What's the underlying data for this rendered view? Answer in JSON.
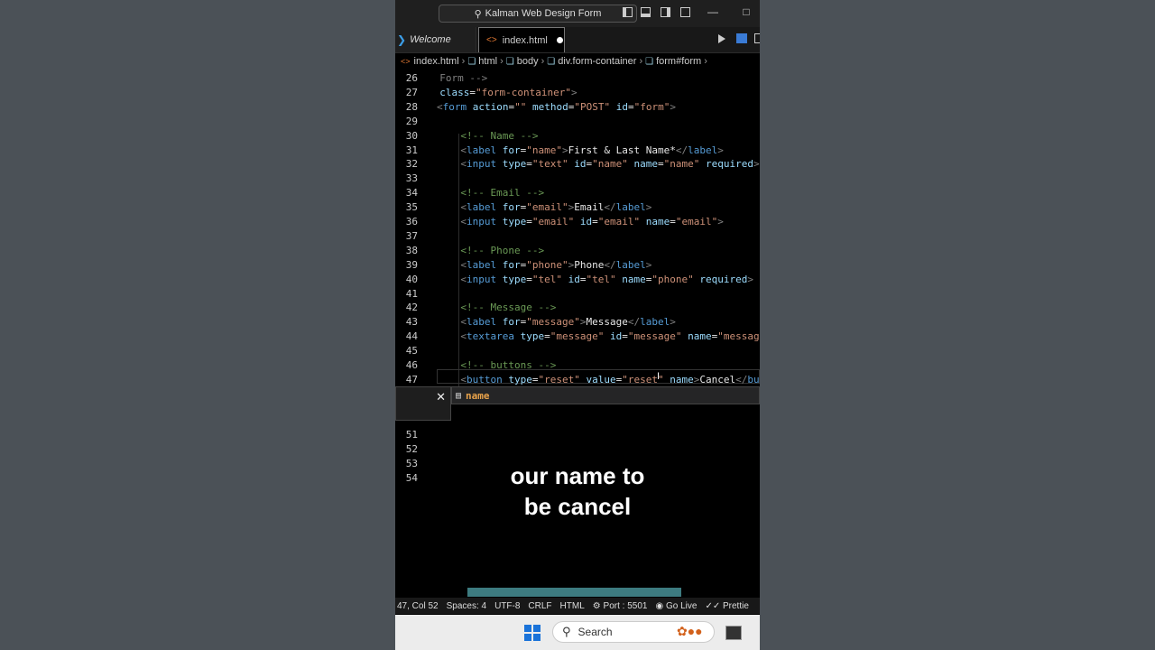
{
  "titlebar": {
    "search_text": "Kalman Web Design Form"
  },
  "tabs": [
    {
      "label": "Welcome"
    },
    {
      "label": "index.html"
    }
  ],
  "breadcrumb": [
    "index.html",
    "html",
    "body",
    "div.form-container",
    "form#form"
  ],
  "editor": {
    "lines": [
      {
        "n": "26",
        "indent": 0.5,
        "parts": [
          {
            "t": "tag",
            "v": "Form -->"
          }
        ]
      },
      {
        "n": "27",
        "indent": 0.5,
        "parts": [
          {
            "t": "attr",
            "v": "class"
          },
          {
            "t": "text",
            "v": "="
          },
          {
            "t": "str",
            "v": "\"form-container\""
          },
          {
            "t": "tag",
            "v": ">"
          }
        ]
      },
      {
        "n": "28",
        "indent": 0,
        "parts": [
          {
            "t": "tag",
            "v": "<"
          },
          {
            "t": "name",
            "v": "form"
          },
          {
            "t": "text",
            "v": " "
          },
          {
            "t": "attr",
            "v": "action"
          },
          {
            "t": "text",
            "v": "="
          },
          {
            "t": "str",
            "v": "\"\""
          },
          {
            "t": "text",
            "v": " "
          },
          {
            "t": "attr",
            "v": "method"
          },
          {
            "t": "text",
            "v": "="
          },
          {
            "t": "str",
            "v": "\"POST\""
          },
          {
            "t": "text",
            "v": " "
          },
          {
            "t": "attr",
            "v": "id"
          },
          {
            "t": "text",
            "v": "="
          },
          {
            "t": "str",
            "v": "\"form\""
          },
          {
            "t": "tag",
            "v": ">"
          }
        ]
      },
      {
        "n": "29",
        "indent": 0,
        "parts": []
      },
      {
        "n": "30",
        "indent": 4,
        "parts": [
          {
            "t": "com",
            "v": "<!-- Name -->"
          }
        ]
      },
      {
        "n": "31",
        "indent": 4,
        "parts": [
          {
            "t": "tag",
            "v": "<"
          },
          {
            "t": "name",
            "v": "label"
          },
          {
            "t": "text",
            "v": " "
          },
          {
            "t": "attr",
            "v": "for"
          },
          {
            "t": "text",
            "v": "="
          },
          {
            "t": "str",
            "v": "\"name\""
          },
          {
            "t": "tag",
            "v": ">"
          },
          {
            "t": "text",
            "v": "First & Last Name*"
          },
          {
            "t": "tag",
            "v": "</"
          },
          {
            "t": "name",
            "v": "label"
          },
          {
            "t": "tag",
            "v": ">"
          }
        ]
      },
      {
        "n": "32",
        "indent": 4,
        "parts": [
          {
            "t": "tag",
            "v": "<"
          },
          {
            "t": "name",
            "v": "input"
          },
          {
            "t": "text",
            "v": " "
          },
          {
            "t": "attr",
            "v": "type"
          },
          {
            "t": "text",
            "v": "="
          },
          {
            "t": "str",
            "v": "\"text\""
          },
          {
            "t": "text",
            "v": " "
          },
          {
            "t": "attr",
            "v": "id"
          },
          {
            "t": "text",
            "v": "="
          },
          {
            "t": "str",
            "v": "\"name\""
          },
          {
            "t": "text",
            "v": " "
          },
          {
            "t": "attr",
            "v": "name"
          },
          {
            "t": "text",
            "v": "="
          },
          {
            "t": "str",
            "v": "\"name\""
          },
          {
            "t": "text",
            "v": " "
          },
          {
            "t": "attr",
            "v": "required"
          },
          {
            "t": "tag",
            "v": ">"
          }
        ]
      },
      {
        "n": "33",
        "indent": 0,
        "parts": []
      },
      {
        "n": "34",
        "indent": 4,
        "parts": [
          {
            "t": "com",
            "v": "<!-- Email -->"
          }
        ]
      },
      {
        "n": "35",
        "indent": 4,
        "parts": [
          {
            "t": "tag",
            "v": "<"
          },
          {
            "t": "name",
            "v": "label"
          },
          {
            "t": "text",
            "v": " "
          },
          {
            "t": "attr",
            "v": "for"
          },
          {
            "t": "text",
            "v": "="
          },
          {
            "t": "str",
            "v": "\"email\""
          },
          {
            "t": "tag",
            "v": ">"
          },
          {
            "t": "text",
            "v": "Email"
          },
          {
            "t": "tag",
            "v": "</"
          },
          {
            "t": "name",
            "v": "label"
          },
          {
            "t": "tag",
            "v": ">"
          }
        ]
      },
      {
        "n": "36",
        "indent": 4,
        "parts": [
          {
            "t": "tag",
            "v": "<"
          },
          {
            "t": "name",
            "v": "input"
          },
          {
            "t": "text",
            "v": " "
          },
          {
            "t": "attr",
            "v": "type"
          },
          {
            "t": "text",
            "v": "="
          },
          {
            "t": "str",
            "v": "\"email\""
          },
          {
            "t": "text",
            "v": " "
          },
          {
            "t": "attr",
            "v": "id"
          },
          {
            "t": "text",
            "v": "="
          },
          {
            "t": "str",
            "v": "\"email\""
          },
          {
            "t": "text",
            "v": " "
          },
          {
            "t": "attr",
            "v": "name"
          },
          {
            "t": "text",
            "v": "="
          },
          {
            "t": "str",
            "v": "\"email\""
          },
          {
            "t": "tag",
            "v": ">"
          }
        ]
      },
      {
        "n": "37",
        "indent": 0,
        "parts": []
      },
      {
        "n": "38",
        "indent": 4,
        "parts": [
          {
            "t": "com",
            "v": "<!-- Phone -->"
          }
        ]
      },
      {
        "n": "39",
        "indent": 4,
        "parts": [
          {
            "t": "tag",
            "v": "<"
          },
          {
            "t": "name",
            "v": "label"
          },
          {
            "t": "text",
            "v": " "
          },
          {
            "t": "attr",
            "v": "for"
          },
          {
            "t": "text",
            "v": "="
          },
          {
            "t": "str",
            "v": "\"phone\""
          },
          {
            "t": "tag",
            "v": ">"
          },
          {
            "t": "text",
            "v": "Phone"
          },
          {
            "t": "tag",
            "v": "</"
          },
          {
            "t": "name",
            "v": "label"
          },
          {
            "t": "tag",
            "v": ">"
          }
        ]
      },
      {
        "n": "40",
        "indent": 4,
        "parts": [
          {
            "t": "tag",
            "v": "<"
          },
          {
            "t": "name",
            "v": "input"
          },
          {
            "t": "text",
            "v": " "
          },
          {
            "t": "attr",
            "v": "type"
          },
          {
            "t": "text",
            "v": "="
          },
          {
            "t": "str",
            "v": "\"tel\""
          },
          {
            "t": "text",
            "v": " "
          },
          {
            "t": "attr",
            "v": "id"
          },
          {
            "t": "text",
            "v": "="
          },
          {
            "t": "str",
            "v": "\"tel\""
          },
          {
            "t": "text",
            "v": " "
          },
          {
            "t": "attr",
            "v": "name"
          },
          {
            "t": "text",
            "v": "="
          },
          {
            "t": "str",
            "v": "\"phone\""
          },
          {
            "t": "text",
            "v": " "
          },
          {
            "t": "attr",
            "v": "required"
          },
          {
            "t": "tag",
            "v": ">"
          }
        ]
      },
      {
        "n": "41",
        "indent": 0,
        "parts": []
      },
      {
        "n": "42",
        "indent": 4,
        "parts": [
          {
            "t": "com",
            "v": "<!-- Message -->"
          }
        ]
      },
      {
        "n": "43",
        "indent": 4,
        "parts": [
          {
            "t": "tag",
            "v": "<"
          },
          {
            "t": "name",
            "v": "label"
          },
          {
            "t": "text",
            "v": " "
          },
          {
            "t": "attr",
            "v": "for"
          },
          {
            "t": "text",
            "v": "="
          },
          {
            "t": "str",
            "v": "\"message\""
          },
          {
            "t": "tag",
            "v": ">"
          },
          {
            "t": "text",
            "v": "Message"
          },
          {
            "t": "tag",
            "v": "</"
          },
          {
            "t": "name",
            "v": "label"
          },
          {
            "t": "tag",
            "v": ">"
          }
        ]
      },
      {
        "n": "44",
        "indent": 4,
        "parts": [
          {
            "t": "tag",
            "v": "<"
          },
          {
            "t": "name",
            "v": "textarea"
          },
          {
            "t": "text",
            "v": " "
          },
          {
            "t": "attr",
            "v": "type"
          },
          {
            "t": "text",
            "v": "="
          },
          {
            "t": "str",
            "v": "\"message\""
          },
          {
            "t": "text",
            "v": " "
          },
          {
            "t": "attr",
            "v": "id"
          },
          {
            "t": "text",
            "v": "="
          },
          {
            "t": "str",
            "v": "\"message\""
          },
          {
            "t": "text",
            "v": " "
          },
          {
            "t": "attr",
            "v": "name"
          },
          {
            "t": "text",
            "v": "="
          },
          {
            "t": "str",
            "v": "\"message"
          }
        ]
      },
      {
        "n": "45",
        "indent": 0,
        "parts": []
      },
      {
        "n": "46",
        "indent": 4,
        "parts": [
          {
            "t": "com",
            "v": "<!-- buttons -->"
          }
        ]
      },
      {
        "n": "47",
        "indent": 4,
        "parts": [
          {
            "t": "tag",
            "v": "<"
          },
          {
            "t": "name",
            "v": "button"
          },
          {
            "t": "text",
            "v": " "
          },
          {
            "t": "attr",
            "v": "type"
          },
          {
            "t": "text",
            "v": "="
          },
          {
            "t": "str",
            "v": "\"reset\""
          },
          {
            "t": "text",
            "v": " "
          },
          {
            "t": "attr",
            "v": "value"
          },
          {
            "t": "text",
            "v": "="
          },
          {
            "t": "str",
            "v": "\"reset\""
          },
          {
            "t": "text",
            "v": " "
          },
          {
            "t": "attr",
            "v": "name"
          },
          {
            "t": "tag",
            "v": ">"
          },
          {
            "t": "text",
            "v": "Cancel"
          },
          {
            "t": "tag",
            "v": "</"
          },
          {
            "t": "name",
            "v": "bu"
          }
        ]
      }
    ],
    "lower_line_numbers": [
      "51",
      "52",
      "53",
      "54"
    ]
  },
  "suggest": {
    "item": "name"
  },
  "caption": {
    "line1": "our name to",
    "line2": "be cancel"
  },
  "statusbar": {
    "position": "47, Col 52",
    "spaces": "Spaces: 4",
    "encoding": "UTF-8",
    "eol": "CRLF",
    "language": "HTML",
    "port": "Port : 5501",
    "golive": "Go Live",
    "prettier": "Prettie"
  },
  "taskbar": {
    "search_placeholder": "Search"
  },
  "colors": {
    "accent": "#3c9ee8",
    "tag": "#808080",
    "name": "#569cd6",
    "attr": "#9cdcfe",
    "string": "#ce9178",
    "comment": "#6a9955",
    "suggest": "#e8a24a"
  }
}
